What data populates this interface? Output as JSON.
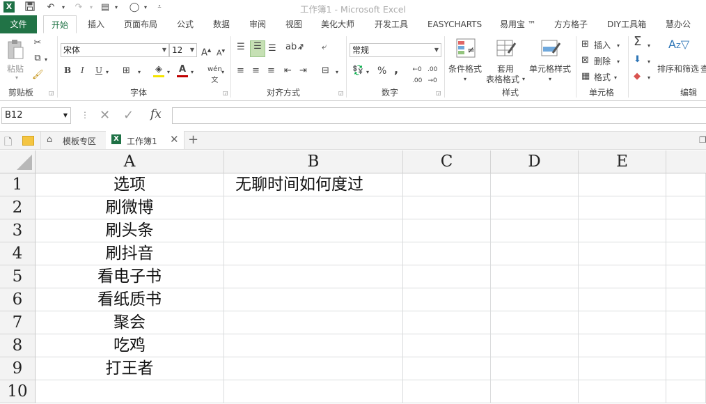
{
  "window": {
    "title": "工作簿1 - Microsoft Excel",
    "app_icon": "X"
  },
  "ribbon_tabs": [
    "文件",
    "开始",
    "插入",
    "页面布局",
    "公式",
    "数据",
    "审阅",
    "视图",
    "美化大师",
    "开发工具",
    "EASYCHARTS",
    "易用宝 ™",
    "方方格子",
    "DIY工具箱",
    "慧办公"
  ],
  "ribbon": {
    "clipboard": {
      "paste": "粘贴",
      "label": "剪贴板"
    },
    "font": {
      "name": "宋体",
      "size": "12",
      "bold": "B",
      "italic": "I",
      "underline": "U",
      "label": "字体"
    },
    "alignment": {
      "label": "对齐方式"
    },
    "number": {
      "format": "常规",
      "percent": "%",
      "comma": ",",
      "label": "数字"
    },
    "styles": {
      "conditional": "条件格式",
      "table_line1": "套用",
      "table_line2": "表格格式",
      "cell_styles": "单元格样式",
      "label": "样式"
    },
    "cells": {
      "insert": "插入",
      "delete": "删除",
      "format": "格式",
      "label": "单元格"
    },
    "editing": {
      "sort_filter": "排序和筛选",
      "find": "查",
      "label": "编辑"
    }
  },
  "formula_bar": {
    "name_box": "B12",
    "fx": "fx",
    "content": ""
  },
  "workbook_tabs": [
    {
      "label": "模板专区"
    },
    {
      "label": "工作簿1"
    }
  ],
  "columns": [
    "A",
    "B",
    "C",
    "D",
    "E"
  ],
  "rows": [
    "1",
    "2",
    "3",
    "4",
    "5",
    "6",
    "7",
    "8",
    "9",
    "10"
  ],
  "cells": {
    "A": [
      "选项",
      "刷微博",
      "刷头条",
      "刷抖音",
      "看电子书",
      "看纸质书",
      "聚会",
      "吃鸡",
      "打王者",
      ""
    ],
    "B1": "无聊时间如何度过"
  },
  "colors": {
    "excel_green": "#217346",
    "header_bg": "#f3f3f3",
    "grid_line": "#dadcdd"
  }
}
